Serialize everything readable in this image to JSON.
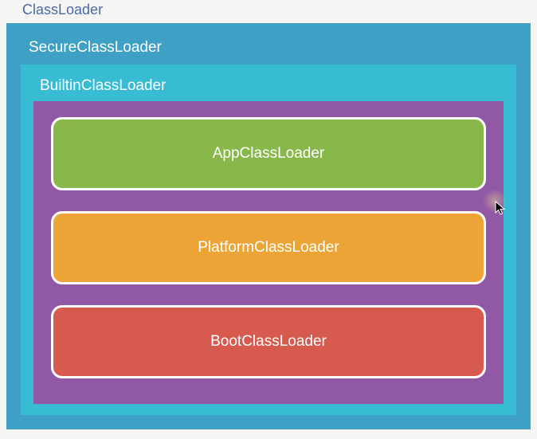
{
  "hierarchy": {
    "root": "ClassLoader",
    "secure": "SecureClassLoader",
    "builtin": "BuiltinClassLoader",
    "loaders": [
      {
        "name": "AppClassLoader",
        "color": "#89b84a"
      },
      {
        "name": "PlatformClassLoader",
        "color": "#eda436"
      },
      {
        "name": "BootClassLoader",
        "color": "#d65a4e"
      }
    ]
  },
  "colors": {
    "classloader_bg": "#3fa0c5",
    "secure_bg": "#38bcd3",
    "builtin_bg": "#9158a6",
    "root_label": "#4a6aa0"
  }
}
